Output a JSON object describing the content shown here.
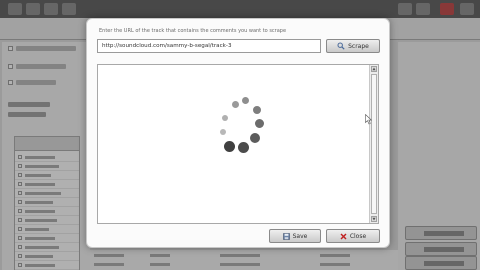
{
  "dialog": {
    "instruction": "Enter the URL of the track that contains the comments you want to scrape",
    "url_value": "http://soundcloud.com/sammy-b-segal/track-3",
    "scrape_label": "Scrape",
    "save_label": "Save",
    "close_label": "Close",
    "status": "loading"
  },
  "icons": {
    "scrape": "magnifier-icon",
    "save": "save-icon",
    "close": "close-x-icon",
    "spinner": "loading-spinner-icon",
    "cursor": "mouse-pointer-icon"
  },
  "colors": {
    "overlay": "#464646",
    "dialog_bg": "#fbfbfb",
    "spinner": "#5a5a5a",
    "close_x": "#c02020"
  }
}
